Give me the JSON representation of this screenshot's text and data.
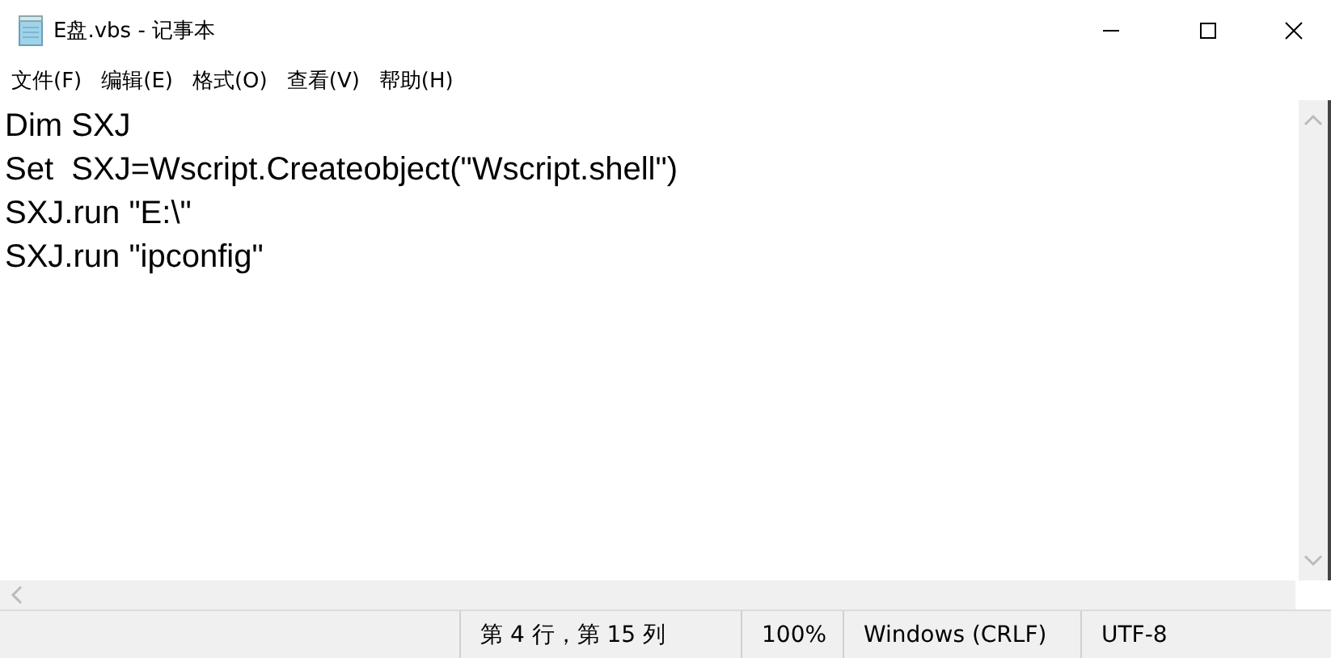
{
  "window": {
    "title": "E盘.vbs - 记事本"
  },
  "menu": [
    {
      "label": "文件(F)"
    },
    {
      "label": "编辑(E)"
    },
    {
      "label": "格式(O)"
    },
    {
      "label": "查看(V)"
    },
    {
      "label": "帮助(H)"
    }
  ],
  "editor": {
    "lines": [
      "Dim SXJ",
      "Set  SXJ=Wscript.Createobject(\"Wscript.shell\")",
      "SXJ.run \"E:\\\"",
      "SXJ.run \"ipconfig\""
    ]
  },
  "status_bar": [
    "第 4 行，第 15 列",
    "100%",
    "Windows (CRLF)",
    "UTF-8"
  ]
}
